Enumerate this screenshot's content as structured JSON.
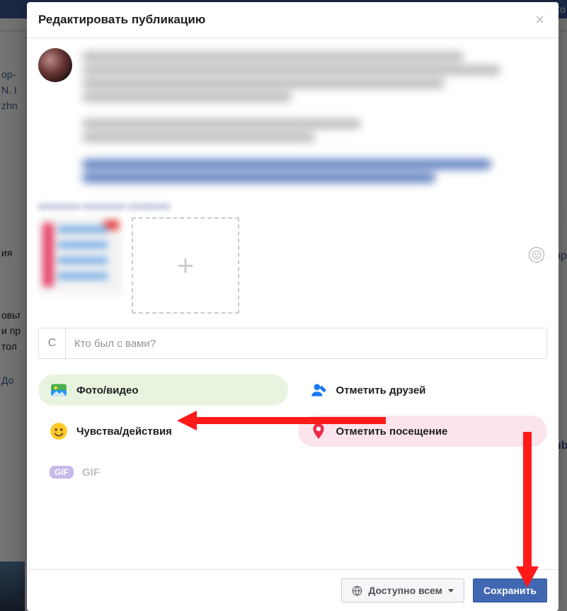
{
  "modal": {
    "title": "Редактировать публикацию",
    "close_aria": "Закрыть"
  },
  "tag_with": {
    "prefix": "С",
    "placeholder": "Кто был с вами?"
  },
  "options": {
    "photo_video": "Фото/видео",
    "tag_friends": "Отметить друзей",
    "feelings": "Чувства/действия",
    "check_in": "Отметить посещение",
    "gif_badge": "GIF",
    "gif_label": "GIF"
  },
  "footer": {
    "privacy_label": "Доступно всем",
    "save_label": "Сохранить"
  },
  "background": {
    "top_right": "Со",
    "left_items": [
      "ор-",
      "N. I",
      "zhn",
      " ",
      "ия",
      " ",
      "овьт",
      "и пр",
      " тол",
      " ",
      "До"
    ],
    "right_items": [
      "к",
      "ор",
      "ub"
    ]
  },
  "icons": {
    "close": "close-icon",
    "emoji": "emoji-icon",
    "plus": "plus-icon",
    "photo": "photo-icon",
    "tag": "tag-friends-icon",
    "feel": "feelings-icon",
    "checkin": "checkin-icon",
    "globe": "globe-icon"
  }
}
